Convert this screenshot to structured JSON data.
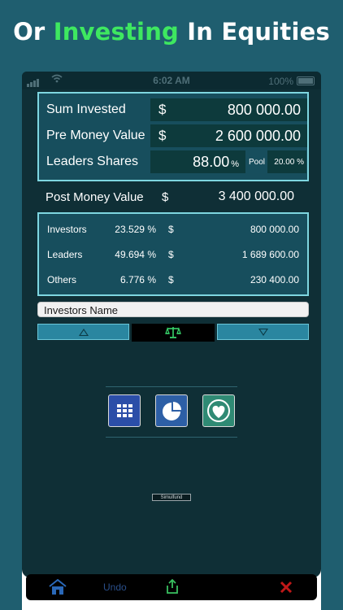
{
  "headline": {
    "part1": "Or ",
    "highlight": "Investing",
    "part2": " In Equities"
  },
  "status_bar": {
    "time": "6:02 AM",
    "battery": "100%"
  },
  "inputs": {
    "sum_invested": {
      "label": "Sum Invested",
      "currency": "$",
      "value": "800 000.00"
    },
    "pre_money": {
      "label": "Pre Money Value",
      "currency": "$",
      "value": "2 600 000.00"
    },
    "leaders_shares": {
      "label": "Leaders Shares",
      "value": "88.00",
      "unit": "%",
      "pool_label": "Pool",
      "pool_value": "20.00 %"
    }
  },
  "post_money": {
    "label": "Post Money Value",
    "currency": "$",
    "value": "3 400 000.00"
  },
  "summary": [
    {
      "name": "Investors",
      "pct": "23.529 %",
      "currency": "$",
      "amount": "800 000.00"
    },
    {
      "name": "Leaders",
      "pct": "49.694 %",
      "currency": "$",
      "amount": "1 689 600.00"
    },
    {
      "name": "Others",
      "pct": "6.776 %",
      "currency": "$",
      "amount": "230 400.00"
    }
  ],
  "investor_name_field": {
    "value": "Investors Name"
  },
  "footer_tag": "Simulfund",
  "toolbar": {
    "undo_label": "Undo"
  },
  "colors": {
    "background": "#1f5e6f",
    "accent_green": "#3ee860",
    "panel_border": "#7ed6e0",
    "panel_fill": "#174e5d"
  },
  "icons": [
    "home-icon",
    "share-icon",
    "close-icon",
    "scale-icon",
    "grid-icon",
    "pie-chart-icon",
    "heart-icon",
    "arrow-up-icon",
    "arrow-down-icon"
  ]
}
